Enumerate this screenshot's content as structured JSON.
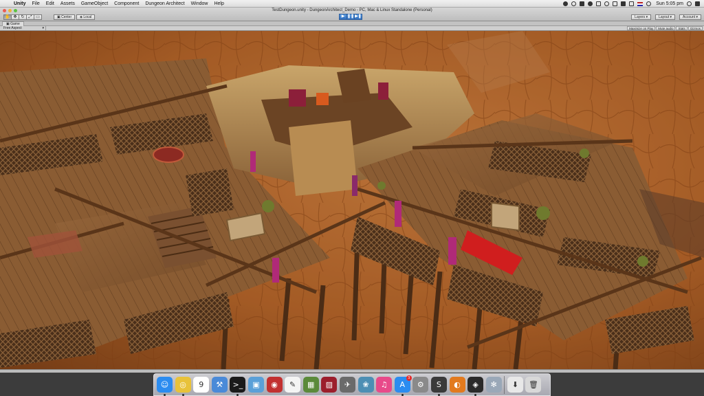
{
  "menubar": {
    "app_name": "Unity",
    "items": [
      "File",
      "Edit",
      "Assets",
      "GameObject",
      "Component",
      "Dungeon Architect",
      "Window",
      "Help"
    ],
    "clock": "Sun 5:05 pm"
  },
  "window": {
    "title": "TestDungeon.unity - DungeonArchitect_Demo - PC, Mac & Linux Standalone (Personal)"
  },
  "toolbar": {
    "tools": [
      "hand",
      "move",
      "rotate",
      "scale",
      "rect"
    ],
    "pivot_label": "Center",
    "space_label": "Local",
    "play": [
      "play",
      "pause",
      "step"
    ],
    "layers_label": "Layers",
    "layout_label": "Layout",
    "account_label": "Account"
  },
  "game_panel": {
    "tab_label": "Game",
    "aspect": "Free Aspect",
    "buttons": [
      "Maximize on Play",
      "Mute audio",
      "Stats",
      "Gizmos"
    ]
  },
  "dock": {
    "apps": [
      {
        "name": "finder",
        "color": "#2b8cf0",
        "glyph": "☺"
      },
      {
        "name": "chrome",
        "color": "#e8c23a",
        "glyph": "◎"
      },
      {
        "name": "calendar",
        "color": "#ffffff",
        "glyph": "9"
      },
      {
        "name": "xcode",
        "color": "#4a8ad8",
        "glyph": "⚒"
      },
      {
        "name": "terminal",
        "color": "#1a1a1a",
        "glyph": ">_"
      },
      {
        "name": "preview",
        "color": "#5aa0d8",
        "glyph": "▣"
      },
      {
        "name": "photo-booth",
        "color": "#c23030",
        "glyph": "◉"
      },
      {
        "name": "textedit",
        "color": "#f4f4f4",
        "glyph": "✎"
      },
      {
        "name": "minecraft",
        "color": "#5b8a3a",
        "glyph": "▦"
      },
      {
        "name": "photo-app",
        "color": "#9c1e2c",
        "glyph": "▨"
      },
      {
        "name": "launchpad",
        "color": "#6a6a6a",
        "glyph": "✈"
      },
      {
        "name": "image-capture",
        "color": "#4d8fb4",
        "glyph": "❀"
      },
      {
        "name": "itunes",
        "color": "#e84a8a",
        "glyph": "♫"
      },
      {
        "name": "app-store",
        "color": "#2a8cf0",
        "glyph": "A",
        "badge": "3"
      },
      {
        "name": "system-preferences",
        "color": "#8a8a8a",
        "glyph": "⚙"
      },
      {
        "name": "sublime-text",
        "color": "#3a3a3a",
        "glyph": "S"
      },
      {
        "name": "blender",
        "color": "#e27a1e",
        "glyph": "◐"
      },
      {
        "name": "unity",
        "color": "#2a2a2a",
        "glyph": "◈"
      },
      {
        "name": "script-editor",
        "color": "#9aa8b8",
        "glyph": "✻"
      },
      {
        "name": "downloads-stack",
        "color": "#e8e8e8",
        "glyph": "⬇"
      },
      {
        "name": "trash",
        "color": "#d8d8d8",
        "glyph": "🗑"
      }
    ]
  }
}
